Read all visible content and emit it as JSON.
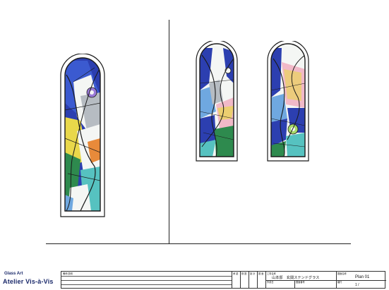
{
  "brand": {
    "line1": "Glass Art",
    "line2": "Atelier Vis-à-Vis"
  },
  "titleblock": {
    "remarks_label": "備考/説明",
    "headers": [
      "承 認",
      "検 図",
      "設 計",
      "図 面"
    ],
    "project_label": "工事名称",
    "project_value": "山本邸　玄関ステンドグラス",
    "drawing_label": "図面名称",
    "drawing_value": "Plan 01",
    "date_label": "作成日",
    "date_value": "",
    "number_label": "図面番号",
    "number_value": "",
    "scale_label": "縮尺",
    "scale_value": "1 / "
  },
  "colors": {
    "lead": "#1a1a1a",
    "blue": "#2c3fb0",
    "light_blue": "#6fa8e0",
    "green": "#2e8a4e",
    "teal": "#56c2c0",
    "yellow": "#e9d84a",
    "white_glass": "#f4f6f4",
    "grey_glass": "#b6bcc2",
    "brand_text": "#1b2a6b"
  },
  "windows": [
    {
      "name": "left-tall-window"
    },
    {
      "name": "middle-window"
    },
    {
      "name": "right-window"
    }
  ]
}
